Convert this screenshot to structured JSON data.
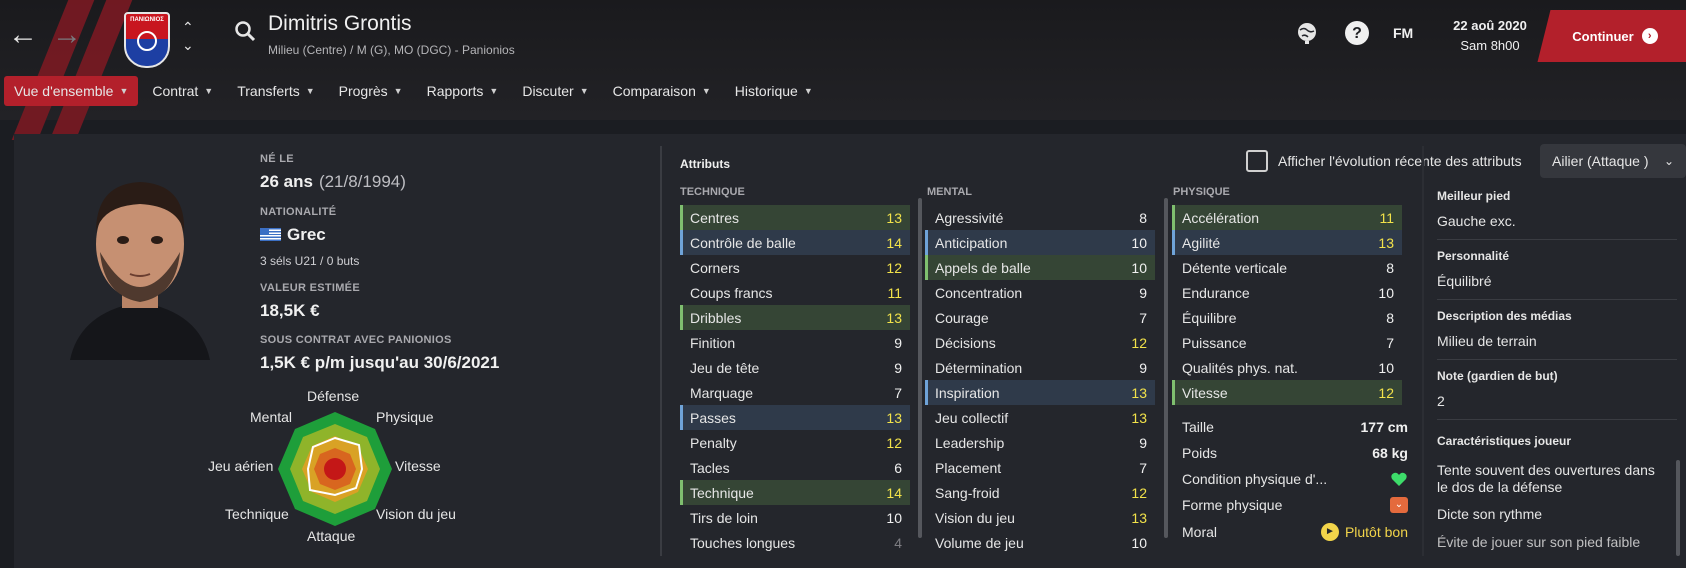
{
  "header": {
    "club_badge_text": "ΠΑΝΙΩΝΙΟΣ",
    "player_name": "Dimitris Grontis",
    "player_subtitle": "Milieu (Centre) / M (G), MO (DGC) - Panionios",
    "tool_icons": [
      "globe-icon",
      "help-icon",
      "fm-icon"
    ],
    "fm_label": "FM",
    "date_line1": "22 aoû 2020",
    "date_line2": "Sam 8h00",
    "continue_label": "Continuer",
    "brand_color": "#b3202b"
  },
  "tabs": [
    {
      "label": "Vue d'ensemble",
      "active": true
    },
    {
      "label": "Contrat"
    },
    {
      "label": "Transferts"
    },
    {
      "label": "Progrès"
    },
    {
      "label": "Rapports"
    },
    {
      "label": "Discuter"
    },
    {
      "label": "Comparaison"
    },
    {
      "label": "Historique"
    }
  ],
  "bio": {
    "born_label": "NÉ LE",
    "age": "26 ans",
    "dob": "(21/8/1994)",
    "nationality_label": "NATIONALITÉ",
    "nationality": "Grec",
    "caps": "3 séls U21 / 0 buts",
    "value_label": "VALEUR ESTIMÉE",
    "value": "18,5K €",
    "contract_label": "SOUS CONTRAT AVEC PANIONIOS",
    "contract": "1,5K € p/m jusqu'au 30/6/2021"
  },
  "radar": {
    "axes": [
      "Défense",
      "Physique",
      "Vitesse",
      "Vision du jeu",
      "Attaque",
      "Technique",
      "Jeu aérien",
      "Mental"
    ]
  },
  "attributes": {
    "title": "Attributs",
    "evolution_label": "Afficher l'évolution récente des attributs",
    "evolution_checked": false,
    "role": "Ailier (Attaque )",
    "technique_header": "TECHNIQUE",
    "mental_header": "MENTAL",
    "physique_header": "PHYSIQUE",
    "technique": [
      {
        "name": "Centres",
        "value": "13",
        "hl": "g",
        "tone": "yellow"
      },
      {
        "name": "Contrôle de balle",
        "value": "14",
        "hl": "b",
        "tone": "yellow"
      },
      {
        "name": "Corners",
        "value": "12",
        "tone": "yellow"
      },
      {
        "name": "Coups francs",
        "value": "11",
        "tone": "yellow"
      },
      {
        "name": "Dribbles",
        "value": "13",
        "hl": "g",
        "tone": "yellow"
      },
      {
        "name": "Finition",
        "value": "9",
        "tone": "white"
      },
      {
        "name": "Jeu de tête",
        "value": "9",
        "tone": "white"
      },
      {
        "name": "Marquage",
        "value": "7",
        "tone": "white"
      },
      {
        "name": "Passes",
        "value": "13",
        "hl": "b",
        "tone": "yellow"
      },
      {
        "name": "Penalty",
        "value": "12",
        "tone": "yellow"
      },
      {
        "name": "Tacles",
        "value": "6",
        "tone": "white"
      },
      {
        "name": "Technique",
        "value": "14",
        "hl": "g",
        "tone": "yellow"
      },
      {
        "name": "Tirs de loin",
        "value": "10",
        "tone": "white"
      },
      {
        "name": "Touches longues",
        "value": "4",
        "tone": "gray"
      }
    ],
    "mental": [
      {
        "name": "Agressivité",
        "value": "8",
        "tone": "white"
      },
      {
        "name": "Anticipation",
        "value": "10",
        "hl": "b",
        "tone": "white"
      },
      {
        "name": "Appels de balle",
        "value": "10",
        "hl": "g",
        "tone": "white"
      },
      {
        "name": "Concentration",
        "value": "9",
        "tone": "white"
      },
      {
        "name": "Courage",
        "value": "7",
        "tone": "white"
      },
      {
        "name": "Décisions",
        "value": "12",
        "tone": "yellow"
      },
      {
        "name": "Détermination",
        "value": "9",
        "tone": "white"
      },
      {
        "name": "Inspiration",
        "value": "13",
        "hl": "b",
        "tone": "yellow"
      },
      {
        "name": "Jeu collectif",
        "value": "13",
        "tone": "yellow"
      },
      {
        "name": "Leadership",
        "value": "9",
        "tone": "white"
      },
      {
        "name": "Placement",
        "value": "7",
        "tone": "white"
      },
      {
        "name": "Sang-froid",
        "value": "12",
        "tone": "yellow"
      },
      {
        "name": "Vision du jeu",
        "value": "13",
        "tone": "yellow"
      },
      {
        "name": "Volume de jeu",
        "value": "10",
        "tone": "white"
      }
    ],
    "physique": [
      {
        "name": "Accélération",
        "value": "11",
        "hl": "g",
        "tone": "yellow"
      },
      {
        "name": "Agilité",
        "value": "13",
        "hl": "b",
        "tone": "yellow"
      },
      {
        "name": "Détente verticale",
        "value": "8",
        "tone": "white"
      },
      {
        "name": "Endurance",
        "value": "10",
        "tone": "white"
      },
      {
        "name": "Équilibre",
        "value": "8",
        "tone": "white"
      },
      {
        "name": "Puissance",
        "value": "7",
        "tone": "white"
      },
      {
        "name": "Qualités phys. nat.",
        "value": "10",
        "tone": "white"
      },
      {
        "name": "Vitesse",
        "value": "12",
        "hl": "g",
        "tone": "yellow"
      }
    ]
  },
  "physical_info": {
    "height_label": "Taille",
    "height": "177 cm",
    "weight_label": "Poids",
    "weight": "68 kg",
    "fitness_label": "Condition physique d'...",
    "form_label": "Forme physique",
    "morale_label": "Moral",
    "morale": "Plutôt bon"
  },
  "side_info": {
    "foot_label": "Meilleur pied",
    "foot": "Gauche exc.",
    "personality_label": "Personnalité",
    "personality": "Équilibré",
    "media_label": "Description des médias",
    "media": "Milieu de terrain",
    "gk_label": "Note (gardien de but)",
    "gk": "2",
    "traits_label": "Caractéristiques joueur",
    "traits": [
      "Tente souvent des ouvertures dans le dos de la défense",
      "Dicte son rythme",
      "Évite de jouer sur son pied faible"
    ]
  }
}
